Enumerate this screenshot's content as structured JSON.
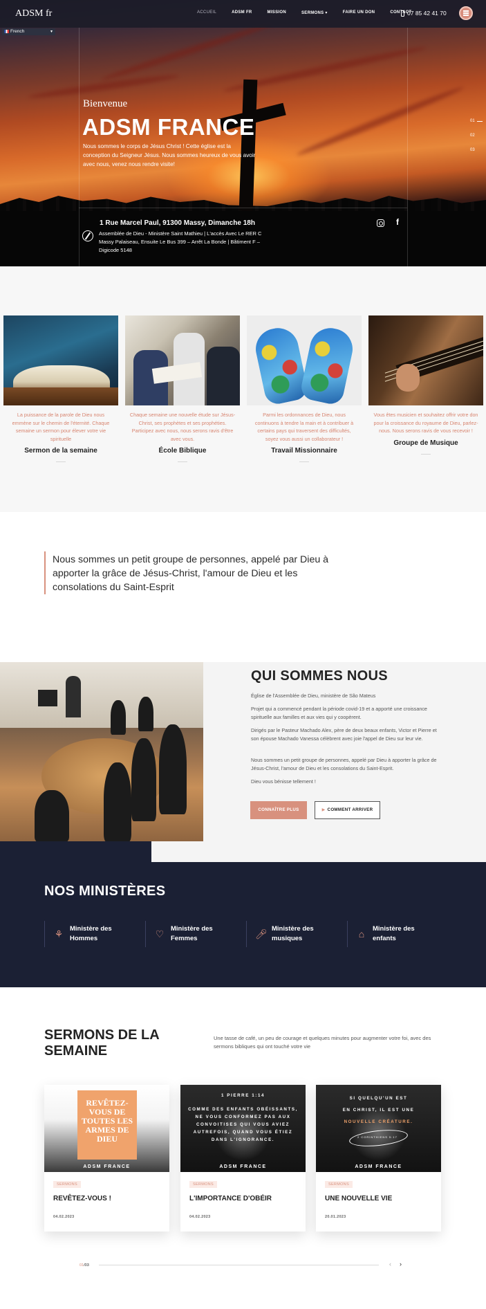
{
  "nav": {
    "brand": "ADSM fr",
    "items": [
      "ACCUEIL",
      "ADSM FR",
      "MISSION",
      "SERMONS ▾",
      "FAIRE UN DON",
      "CONTACT"
    ],
    "phone": "07 85 42 41 70",
    "language": "French"
  },
  "hero": {
    "welcome": "Bienvenue",
    "title": "ADSM FRANCE",
    "description": "Nous sommes le corps de Jésus Christ ! Cette église est la conception du Seigneur Jésus. Nous sommes heureux de vous avoir avec nous, venez nous rendre visite!",
    "slides": [
      "01",
      "02",
      "03"
    ],
    "address": "1 Rue Marcel Paul, 91300 Massy, Dimanche 18h",
    "address_detail": "Assemblée de Dieu - Ministère Saint Mathieu | L'accès Avec Le RER C Massy Palaiseau, Ensuite Le Bus 399 – Arrêt La Bonde | Bâtiment F – Digicode 5148"
  },
  "services": [
    {
      "title": "Sermon de la semaine",
      "text": "La puissance de la parole de Dieu nous emmène sur le chemin de l'éternité. Chaque semaine un sermon pour élever votre vie spirituelle"
    },
    {
      "title": "École Biblique",
      "text": "Chaque semaine une nouvelle étude sur Jésus-Christ, ses prophètes et ses prophéties. Participez avec nous, nous serons ravis d'être avec vous."
    },
    {
      "title": "Travail Missionnaire",
      "text": "Parmi les ordonnances de Dieu, nous continuons à tendre la main et à contribuer à certains pays qui traversent des difficultés, soyez vous aussi un collaborateur !"
    },
    {
      "title": "Groupe de Musique",
      "text": "Vous êtes musicien et souhaitez offrir votre don pour la croissance du royaume de Dieu, parlez-nous. Nous serons ravis de vous recevoir !"
    }
  ],
  "quote": "Nous sommes un petit groupe de personnes, appelé par Dieu à apporter la grâce de Jésus-Christ, l'amour de Dieu et les consolations du Saint-Esprit",
  "about": {
    "title": "QUI SOMMES NOUS",
    "p1": "Église de l'Assemblée de Dieu, ministère de São Mateus",
    "p2": "Projet qui a commencé pendant la période covid-19 et a apporté une croissance spirituelle aux familles et aux vies qui y coopèrent.",
    "p3": "Dirigés par le Pasteur Machado Alex, père de deux beaux enfants, Victor et Pierre et son épouse Machado Vanessa célèbrent avec joie l'appel de Dieu sur leur vie.",
    "p4": "Nous sommes un petit groupe de personnes, appelé par Dieu à apporter la grâce de Jésus-Christ, l'amour de Dieu et les consolations du Saint-Esprit.",
    "p5": "Dieu vous bénisse tellement !",
    "btn_learn": "CONNAÎTRE PLUS",
    "btn_arrive": "COMMENT ARRIVER"
  },
  "ministries": {
    "title": "NOS MINISTÈRES",
    "items": [
      {
        "label1": "Ministère des",
        "label2": "Hommes",
        "icon": "men-icon"
      },
      {
        "label1": "Ministère des",
        "label2": "Femmes",
        "icon": "heart-icon"
      },
      {
        "label1": "Ministère des",
        "label2": "musiques",
        "icon": "microphone-icon"
      },
      {
        "label1": "Ministère des",
        "label2": "enfants",
        "icon": "house-icon"
      }
    ]
  },
  "sermons": {
    "title": "SERMONS DE LA SEMAINE",
    "description": "Une tasse de café, un peu de courage et quelques minutes pour augmenter votre foi, avec des sermons bibliques qui ont touché votre vie",
    "cards": [
      {
        "tag": "SERMONS",
        "title": "REVÊTEZ-VOUS !",
        "date": "04.02.2023",
        "img_text": "REVÊTEZ-VOUS DE TOUTES LES ARMES DE DIEU",
        "img_ref": "",
        "img_footer": "ADSM FRANCE"
      },
      {
        "tag": "SERMONS",
        "title": "L'IMPORTANCE D'OBÉIR",
        "date": "04.02.2023",
        "img_heading": "1 PIERRE 1:14",
        "img_text": "COMME DES ENFANTS OBÉISSANTS, NE VOUS CONFORMEZ PAS AUX CONVOITISES QUI VOUS AVIEZ AUTREFOIS, QUAND VOUS ÉTIEZ DANS L'IGNORANCE.",
        "img_footer": "ADSM FRANCE"
      },
      {
        "tag": "SERMONS",
        "title": "UNE NOUVELLE VIE",
        "date": "20.01.2023",
        "img_l1": "SI QUELQU'UN EST",
        "img_l2": "EN CHRIST, IL EST UNE",
        "img_l3": "NOUVELLE CRÉATURE.",
        "img_ref": "2 CORINTHIENS 5:17",
        "img_footer": "ADSM FRANCE"
      }
    ],
    "pager_current": "01",
    "pager_total": "/03"
  },
  "colors": {
    "accent": "#d8917e",
    "navy": "#1b2034",
    "light_bg": "#f4f4f4"
  }
}
